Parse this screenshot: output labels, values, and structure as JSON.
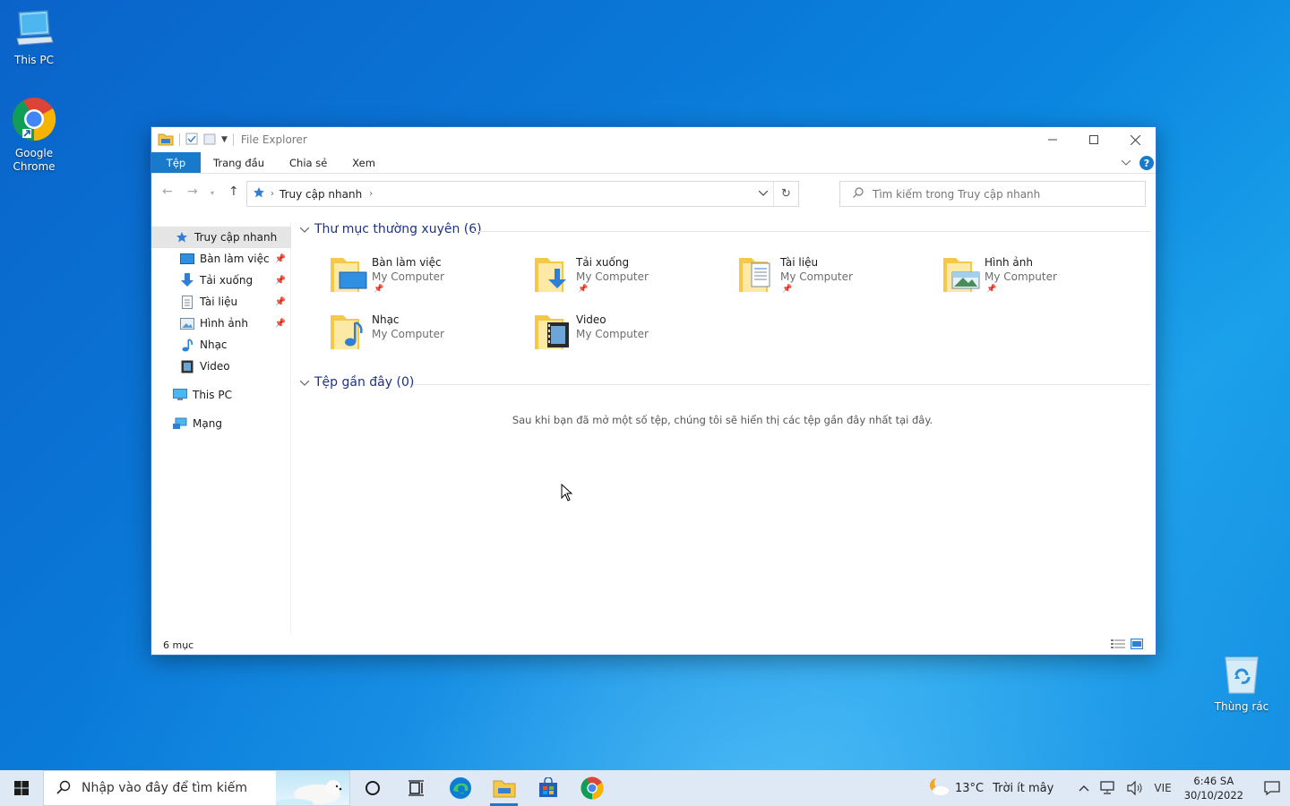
{
  "desktop": {
    "icons": [
      {
        "label": "This PC"
      },
      {
        "label_line1": "Google",
        "label_line2": "Chrome"
      },
      {
        "label": "Thùng rác"
      }
    ]
  },
  "window": {
    "title": "File Explorer",
    "ribbon_tabs": [
      "Tệp",
      "Trang đầu",
      "Chia sẻ",
      "Xem"
    ],
    "help_label": "?",
    "address": {
      "crumb": "Truy cập nhanh"
    },
    "search": {
      "placeholder": "Tìm kiếm trong Truy cập nhanh"
    },
    "nav": {
      "quick_access": "Truy cập nhanh",
      "items": [
        "Bàn làm việc",
        "Tải xuống",
        "Tài liệu",
        "Hình ảnh",
        "Nhạc",
        "Video"
      ],
      "this_pc": "This PC",
      "network": "Mạng"
    },
    "frequent": {
      "header": "Thư mục thường xuyên (6)",
      "folders": [
        {
          "name": "Bàn làm việc",
          "location": "My Computer",
          "pinned": true
        },
        {
          "name": "Tải xuống",
          "location": "My Computer",
          "pinned": true
        },
        {
          "name": "Tài liệu",
          "location": "My Computer",
          "pinned": true
        },
        {
          "name": "Hình ảnh",
          "location": "My Computer",
          "pinned": true
        },
        {
          "name": "Nhạc",
          "location": "My Computer",
          "pinned": false
        },
        {
          "name": "Video",
          "location": "My Computer",
          "pinned": false
        }
      ]
    },
    "recent": {
      "header": "Tệp gần đây (0)",
      "empty_message": "Sau khi bạn đã mở một số tệp, chúng tôi sẽ hiển thị các tệp gần đây nhất tại đây."
    },
    "status": "6 mục"
  },
  "taskbar": {
    "search_placeholder": "Nhập vào đây để tìm kiếm",
    "weather": {
      "temp": "13°C",
      "desc": "Trời ít mây"
    },
    "language": "VIE",
    "time": "6:46 SA",
    "date": "30/10/2022"
  },
  "colors": {
    "accent": "#1979ca",
    "group_header": "#1e3287",
    "folder_yellow": "#f5c84a"
  }
}
